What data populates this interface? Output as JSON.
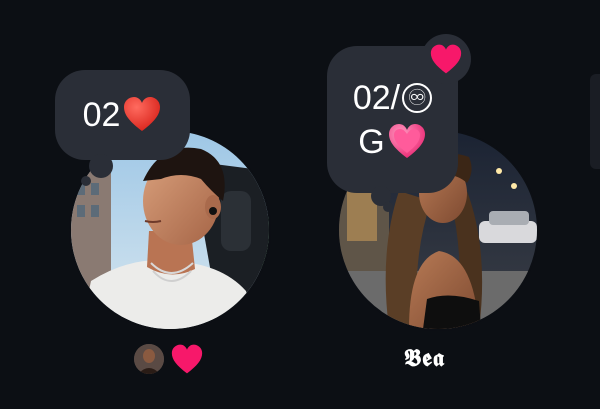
{
  "notes": [
    {
      "line1_text": "02",
      "line1_emoji": "red-heart"
    },
    {
      "line1_text": "02/",
      "line1_symbol": "♾",
      "line2_text": "G",
      "line2_emoji": "pink-heart"
    }
  ],
  "users": [
    {
      "label": "",
      "label_icon": "pink-heart"
    },
    {
      "label": "𝕭𝖊𝖆"
    }
  ],
  "colors": {
    "background": "#0c0f14",
    "bubble": "#2a2e37",
    "heart_red": "#e0261f",
    "heart_pink": "#f7186a"
  }
}
